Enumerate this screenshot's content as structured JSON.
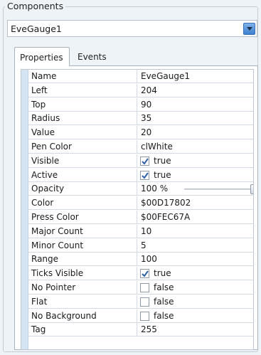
{
  "group": {
    "title": "Components"
  },
  "combo": {
    "value": "EveGauge1"
  },
  "tabs": [
    {
      "label": "Properties",
      "active": true
    },
    {
      "label": "Events",
      "active": false
    }
  ],
  "properties": [
    {
      "name": "Name",
      "value": "EveGauge1",
      "type": "text"
    },
    {
      "name": "Left",
      "value": "204",
      "type": "text"
    },
    {
      "name": "Top",
      "value": "90",
      "type": "text"
    },
    {
      "name": "Radius",
      "value": "35",
      "type": "text"
    },
    {
      "name": "Value",
      "value": "20",
      "type": "text"
    },
    {
      "name": "Pen Color",
      "value": "clWhite",
      "type": "text"
    },
    {
      "name": "Visible",
      "value": "true",
      "type": "checkbox",
      "checked": true
    },
    {
      "name": "Active",
      "value": "true",
      "type": "checkbox",
      "checked": true
    },
    {
      "name": "Opacity",
      "value": "100 %",
      "type": "slider",
      "level": 1.0
    },
    {
      "name": "Color",
      "value": "$00D17802",
      "type": "text"
    },
    {
      "name": "Press Color",
      "value": "$00FEC67A",
      "type": "text"
    },
    {
      "name": "Major Count",
      "value": "10",
      "type": "text"
    },
    {
      "name": "Minor Count",
      "value": "5",
      "type": "text"
    },
    {
      "name": "Range",
      "value": "100",
      "type": "text"
    },
    {
      "name": "Ticks Visible",
      "value": "true",
      "type": "checkbox",
      "checked": true
    },
    {
      "name": "No Pointer",
      "value": "false",
      "type": "checkbox",
      "checked": false
    },
    {
      "name": "Flat",
      "value": "false",
      "type": "checkbox",
      "checked": false
    },
    {
      "name": "No Background",
      "value": "false",
      "type": "checkbox",
      "checked": false
    },
    {
      "name": "Tag",
      "value": "255",
      "type": "text"
    }
  ],
  "colors": {
    "accent": "#3d7fd0",
    "gutter": "#d4e4f3",
    "check": "#2f5fa8"
  }
}
